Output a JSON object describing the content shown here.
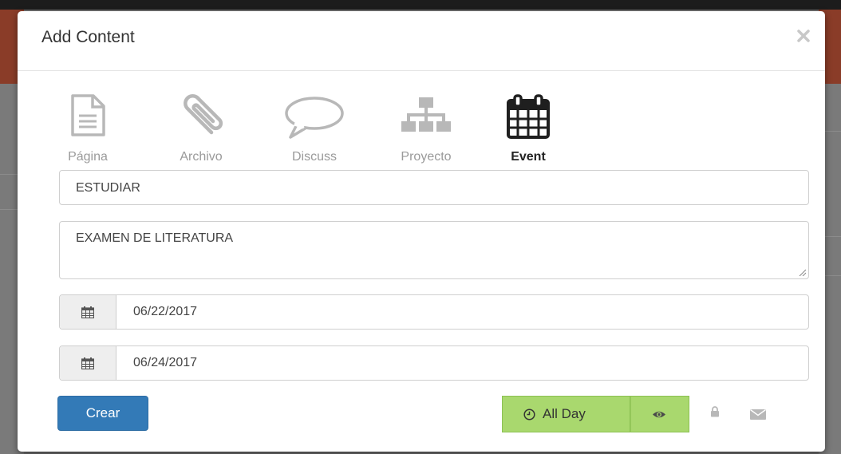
{
  "modal": {
    "title": "Add Content"
  },
  "content_types": [
    {
      "label": "Página",
      "icon": "document-icon",
      "active": false
    },
    {
      "label": "Archivo",
      "icon": "paperclip-icon",
      "active": false
    },
    {
      "label": "Discuss",
      "icon": "speech-bubble-icon",
      "active": false
    },
    {
      "label": "Proyecto",
      "icon": "sitemap-icon",
      "active": false
    },
    {
      "label": "Event",
      "icon": "calendar-icon",
      "active": true
    }
  ],
  "form": {
    "title_value": "ESTUDIAR",
    "description_value": "EXAMEN DE LITERATURA",
    "start_date": "06/22/2017",
    "end_date": "06/24/2017"
  },
  "footer": {
    "submit_label": "Crear",
    "allday_label": "All Day"
  },
  "colors": {
    "primary": "#337ab7",
    "toggle_active": "#a9d86e",
    "muted_icon": "#b8b8b8"
  }
}
